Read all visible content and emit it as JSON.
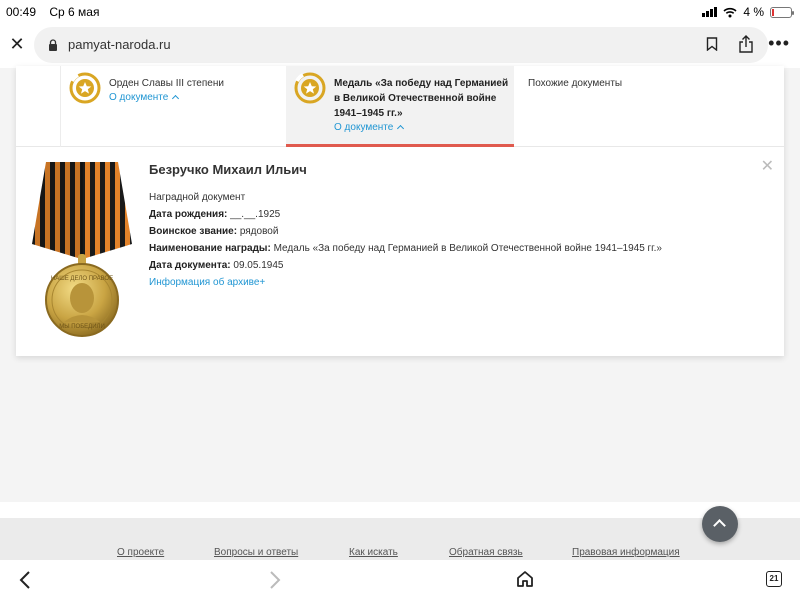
{
  "status": {
    "time": "00:49",
    "date": "Ср 6 мая",
    "battery": "4 %"
  },
  "browser": {
    "url": "pamyat-naroda.ru",
    "tab_count": "21"
  },
  "tabs": [
    {
      "label": "Орден Славы III степени",
      "link": "О документе"
    },
    {
      "label": "Медаль «За победу над Германией в Великой Отечественной войне 1941–1945 гг.»",
      "link": "О документе"
    },
    {
      "label": "Похожие документы"
    }
  ],
  "person": {
    "name": "Безручко Михаил Ильич",
    "doc_type": "Наградной документ",
    "birth_label": "Дата рождения:",
    "birth_value": "__.__.1925",
    "rank_label": "Воинское звание:",
    "rank_value": "рядовой",
    "award_label": "Наименование награды:",
    "award_value": "Медаль «За победу над Германией в Великой Отечественной войне 1941–1945 гг.»",
    "date_label": "Дата документа:",
    "date_value": "09.05.1945",
    "archive_link": "Информация об архиве+"
  },
  "medal_text": {
    "top": "НАШЕ ДЕЛО ПРАВОЕ",
    "bottom": "МЫ ПОБЕДИЛИ"
  },
  "footer": {
    "links": [
      "О проекте",
      "Вопросы и ответы",
      "Как искать",
      "Обратная связь",
      "Правовая информация"
    ]
  },
  "colors": {
    "accent": "#2196d3",
    "active_tab_border": "#e05a4e",
    "medal_gold": "#d9a623"
  }
}
